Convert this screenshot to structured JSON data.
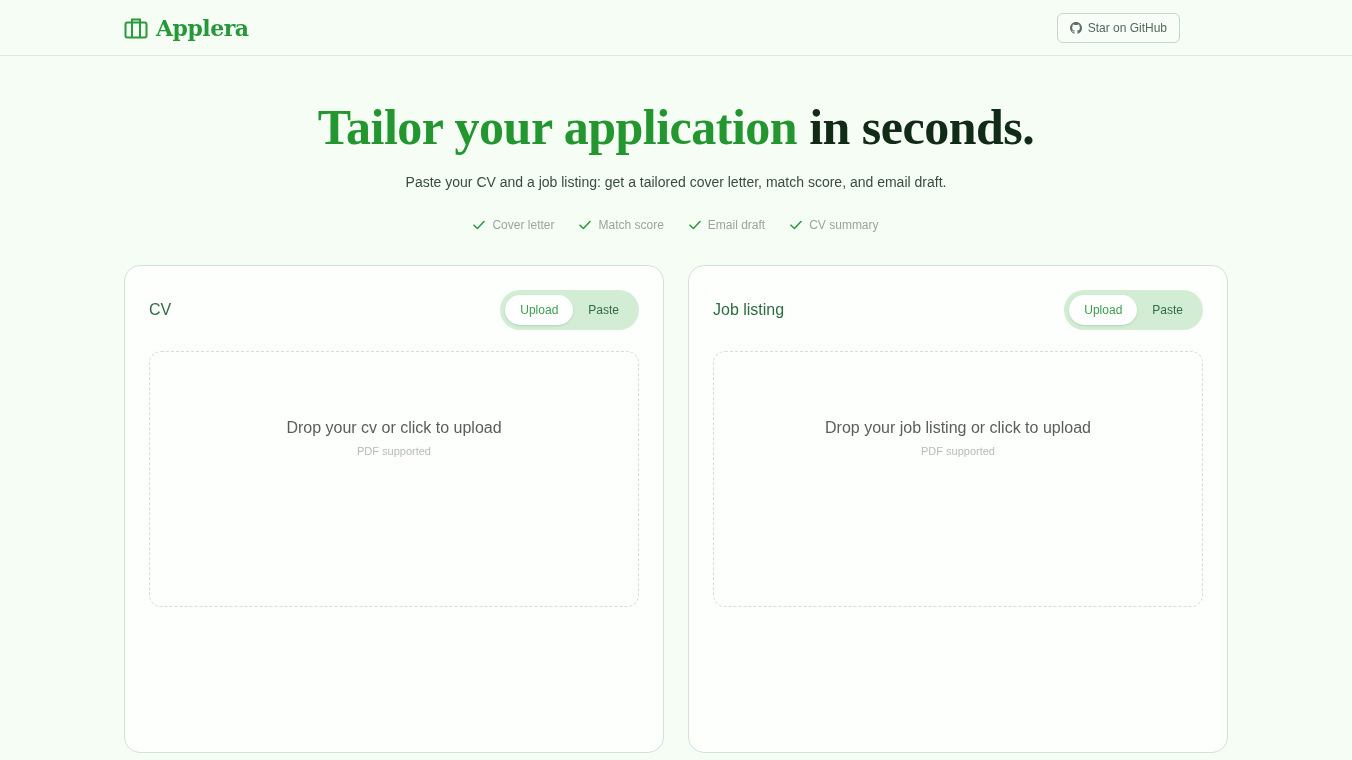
{
  "header": {
    "logo": "Applera",
    "github_button": "Star on GitHub"
  },
  "hero": {
    "headline": {
      "highlight": "Tailor your application",
      "rest": "in seconds."
    },
    "subtitle": "Paste your CV and a job listing: get a tailored cover letter, match score, and email draft.",
    "features": [
      "Cover letter",
      "Match score",
      "Email draft",
      "CV summary"
    ]
  },
  "cards": [
    {
      "title": "CV",
      "tabs": [
        {
          "label": "Upload",
          "selected": true
        },
        {
          "label": "Paste",
          "selected": false
        }
      ],
      "dropzone": {
        "text": "Drop your cv or click to upload",
        "hint": "PDF supported"
      }
    },
    {
      "title": "Job listing",
      "tabs": [
        {
          "label": "Upload",
          "selected": true
        },
        {
          "label": "Paste",
          "selected": false
        }
      ],
      "dropzone": {
        "text": "Drop your job listing or click to upload",
        "hint": "PDF supported"
      }
    }
  ]
}
